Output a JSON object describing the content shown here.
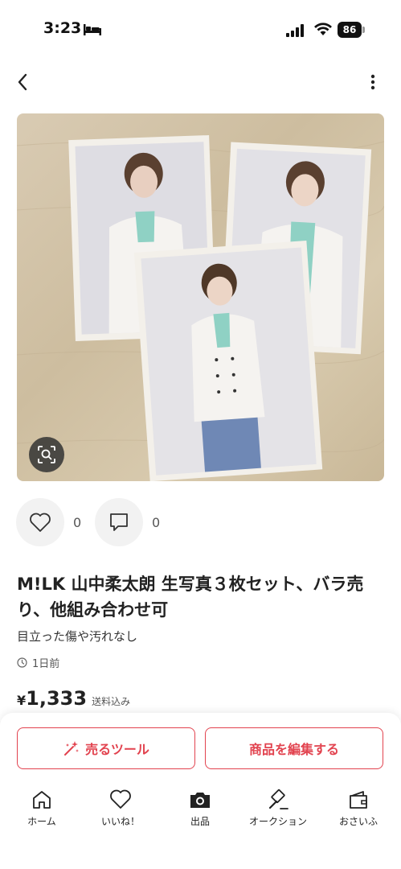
{
  "status_bar": {
    "time": "3:23",
    "battery": "86"
  },
  "listing": {
    "like_count": "0",
    "comment_count": "0",
    "title": "M!LK 山中柔太朗 生写真３枚セット、バラ売り、他組み合わせ可",
    "condition": "目立った傷や汚れなし",
    "posted": "1日前",
    "price_symbol": "¥",
    "price": "1,333",
    "shipping": "送料込み"
  },
  "actions": {
    "sell_tool_label": "売るツール",
    "edit_label": "商品を編集する"
  },
  "tabbar": {
    "home": "ホーム",
    "likes": "いいね！",
    "sell": "出品",
    "auction": "オークション",
    "wallet": "おさいふ"
  },
  "colors": {
    "accent": "#e2434f"
  }
}
